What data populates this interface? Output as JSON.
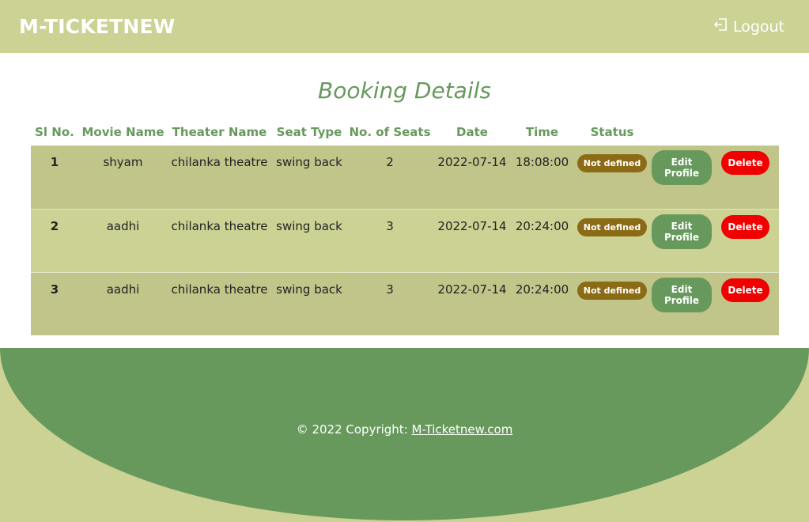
{
  "navbar": {
    "brand": "M-TICKETNEW",
    "logout_label": "Logout",
    "logout_icon": "logout-icon"
  },
  "page": {
    "title": "Booking Details"
  },
  "table": {
    "headers": [
      "Sl No.",
      "Movie Name",
      "Theater Name",
      "Seat Type",
      "No. of Seats",
      "Date",
      "Time",
      "Status"
    ],
    "rows": [
      {
        "sl": "1",
        "movie": "shyam",
        "theater": "chilanka theatre",
        "seat_type": "swing back",
        "seats": "2",
        "date": "2022-07-14",
        "time": "18:08:00",
        "status": "Not defined",
        "edit_label": "Edit Profile",
        "delete_label": "Delete"
      },
      {
        "sl": "2",
        "movie": "aadhi",
        "theater": "chilanka theatre",
        "seat_type": "swing back",
        "seats": "3",
        "date": "2022-07-14",
        "time": "20:24:00",
        "status": "Not defined",
        "edit_label": "Edit Profile",
        "delete_label": "Delete"
      },
      {
        "sl": "3",
        "movie": "aadhi",
        "theater": "chilanka theatre",
        "seat_type": "swing back",
        "seats": "3",
        "date": "2022-07-14",
        "time": "20:24:00",
        "status": "Not defined",
        "edit_label": "Edit Profile",
        "delete_label": "Delete"
      }
    ]
  },
  "footer": {
    "copyright_prefix": "© 2022 Copyright: ",
    "copyright_link": "M-Ticketnew.com"
  },
  "colors": {
    "nav_bg": "#cbd293",
    "accent_green": "#67995d",
    "status_badge": "#8b6b16",
    "delete_red": "#f00000"
  }
}
